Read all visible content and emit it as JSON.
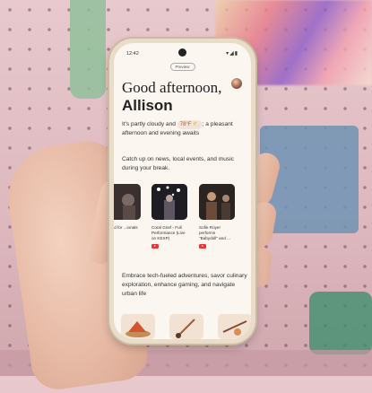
{
  "status_bar": {
    "time": "12:42",
    "icons": "▾◢▮"
  },
  "header": {
    "pill_label": "Preview"
  },
  "greeting": {
    "line1": "Good afternoon,",
    "name": "Allison"
  },
  "weather": {
    "before": "It's partly cloudy and ",
    "temperature": "78°F",
    "after": "; a pleasant afternoon and evening awaits"
  },
  "catch_up_text": "Catch up on news, local events, and music during your break.",
  "cards": [
    {
      "caption": "...ated for ...ionals on",
      "icon": "youtube-icon"
    },
    {
      "caption": "Coral Grief - Full Performance (Live on KEXP)",
      "icon": "youtube-icon"
    },
    {
      "caption": "Sofie Royer performs \"Babydoll\" and ...",
      "icon": "youtube-icon"
    }
  ],
  "embrace_text": "Embrace tech-fueled adventures, savor culinary exploration, enhance gaming, and navigate urban life"
}
